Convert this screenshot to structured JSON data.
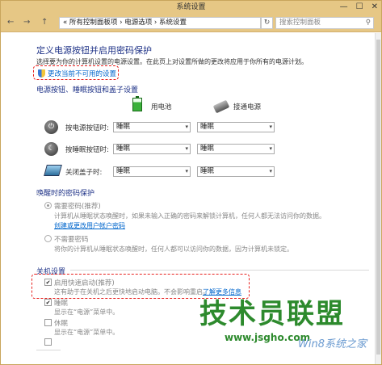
{
  "window": {
    "title": "系统设置",
    "buttons": {
      "minimize": "—",
      "maximize": "☐",
      "close": "✕"
    }
  },
  "address": {
    "back": "←",
    "forward": "→",
    "up": "↑",
    "crumbs": "« 所有控制面板项 › 电源选项 › 系统设置",
    "refresh": "↻",
    "search_placeholder": "搜索控制面板"
  },
  "main": {
    "heading": "定义电源按钮并启用密码保护",
    "description": "选择要为你的计算机设置的电源设置。在此页上对设置所做的更改将应用于你所有的电源计划。",
    "change_link": "更改当前不可用的设置",
    "power_section_title": "电源按钮、睡眠按钮和盖子设置",
    "col_battery": "用电池",
    "col_plugged": "接通电源",
    "rows": [
      {
        "label": "按电源按钮时:",
        "battery": "睡眠",
        "plugged": "睡眠"
      },
      {
        "label": "按睡眠按钮时:",
        "battery": "睡眠",
        "plugged": "睡眠"
      },
      {
        "label": "关闭盖子时:",
        "battery": "睡眠",
        "plugged": "睡眠"
      }
    ],
    "wake_section_title": "唤醒时的密码保护",
    "require_password_label": "需要密码(推荐)",
    "require_password_desc": "计算机从睡眠状态唤醒时，如果未输入正确的密码来解锁计算机，任何人都无法访问你的数据。",
    "require_password_link": "创建或更改用户帐户密码",
    "no_password_label": "不需要密码",
    "no_password_desc": "将你的计算机从睡眠状态唤醒时，任何人都可以访问你的数据，因为计算机未锁定。",
    "shutdown_section_title": "关机设置",
    "fast_startup_label": "启用快速启动(推荐)",
    "fast_startup_desc": "这有助于在关机之后更快地启动电脑。不会影响重启。",
    "fast_startup_link": "了解更多信息",
    "sleep_label": "睡眠",
    "sleep_desc": "显示在“电源”菜单中。",
    "hibernate_label": "休眠",
    "hibernate_desc": "显示在“电源”菜单中。",
    "check_mark": "✔",
    "select_arrow": "▾"
  },
  "watermark": {
    "big": "技术员联盟",
    "url": "www.jsgho.com",
    "win": "Win8系统之家"
  },
  "colors": {
    "titlebar": "#e6c785",
    "heading": "#1e3287",
    "link": "#0066cc",
    "highlight": "#e8201e"
  }
}
